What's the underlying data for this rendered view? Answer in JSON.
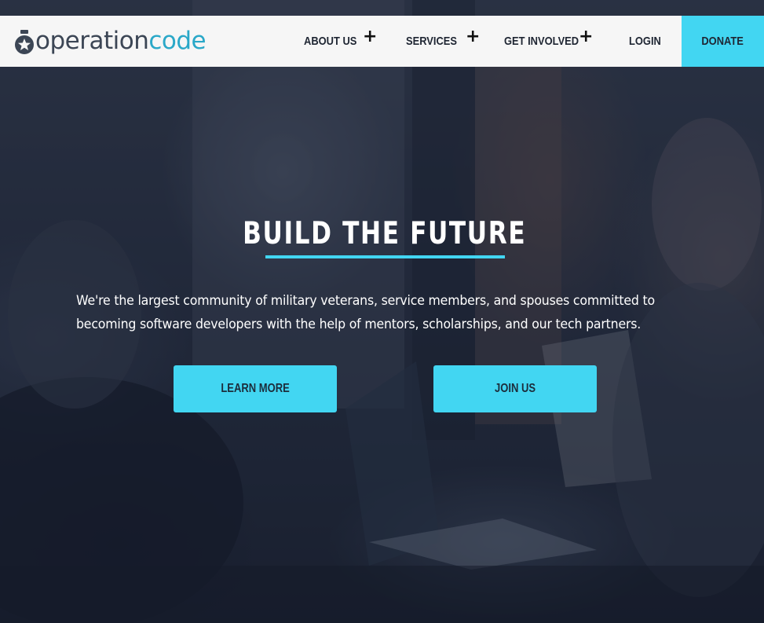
{
  "header": {
    "logo": {
      "text_operation": "operation",
      "text_code": "code",
      "icon": "star-medal-icon"
    },
    "nav": {
      "about_us": "ABOUT US",
      "services": "SERVICES",
      "get_involved": "GET INVOLVED",
      "login": "LOGIN",
      "donate": "DONATE",
      "expand_icon": "+"
    }
  },
  "hero": {
    "title": "BUILD THE FUTURE",
    "description": "We're the largest community of military veterans, service members, and spouses committed to becoming software developers with the help of mentors, scholarships, and our tech partners.",
    "buttons": {
      "learn_more": "LEARN MORE",
      "join_us": "JOIN US"
    }
  },
  "colors": {
    "accent": "#42d6f2",
    "logo_dark": "#3c4655",
    "logo_code": "#2aa8c8",
    "navbar_bg": "#f6f6f6"
  }
}
